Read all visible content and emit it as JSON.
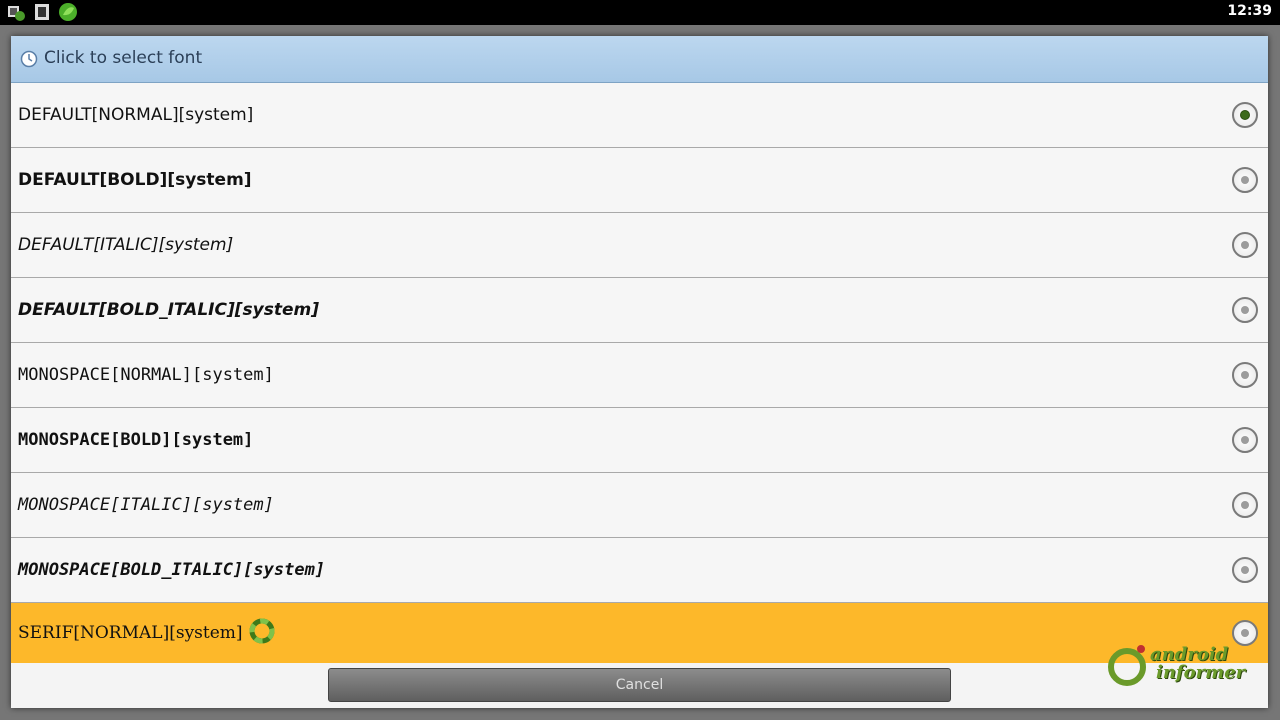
{
  "status_bar": {
    "time": "12:39",
    "icons": [
      "usb-debug-icon",
      "sd-card-icon",
      "app-leaf-icon"
    ]
  },
  "dialog": {
    "title": "Click to select font",
    "title_icon": "clock-icon",
    "options": [
      {
        "label": "DEFAULT[NORMAL][system]",
        "checked": true
      },
      {
        "label": "DEFAULT[BOLD][system]",
        "checked": false
      },
      {
        "label": "DEFAULT[ITALIC][system]",
        "checked": false
      },
      {
        "label": "DEFAULT[BOLD_ITALIC][system]",
        "checked": false
      },
      {
        "label": "MONOSPACE[NORMAL][system]",
        "checked": false
      },
      {
        "label": "MONOSPACE[BOLD][system]",
        "checked": false
      },
      {
        "label": "MONOSPACE[ITALIC][system]",
        "checked": false
      },
      {
        "label": "MONOSPACE[BOLD_ITALIC][system]",
        "checked": false
      },
      {
        "label": "SERIF[NORMAL][system]",
        "checked": false,
        "highlighted": true
      }
    ],
    "cancel_label": "Cancel"
  },
  "watermark": {
    "line1": "android",
    "line2": "informer"
  },
  "colors": {
    "highlight": "#fdb82a",
    "title_bar": "#b3cfea",
    "radio_checked": "#3d6b1c"
  }
}
